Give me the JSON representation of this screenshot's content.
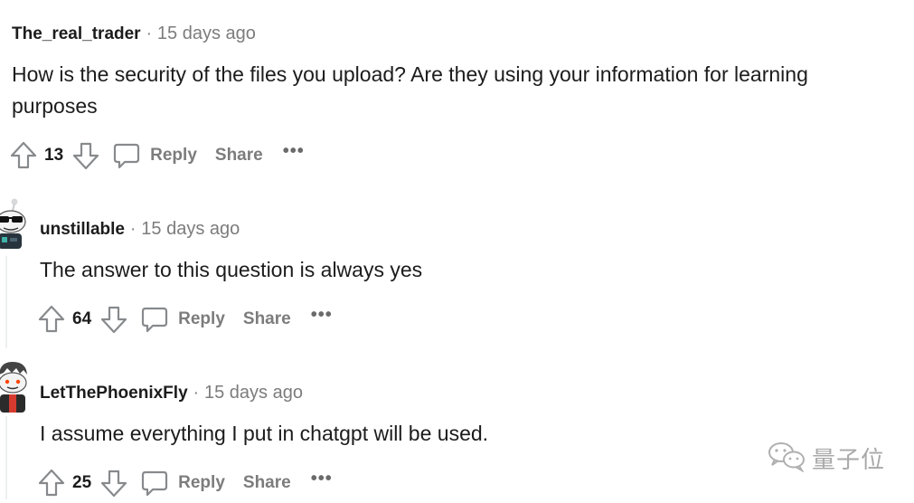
{
  "comments": [
    {
      "author": "The_real_trader",
      "separator": "·",
      "time": "15 days ago",
      "text": "How is the security of the files you upload? Are they using your information for learning purposes",
      "votes": "13",
      "reply_label": "Reply",
      "share_label": "Share",
      "more_label": "•••"
    },
    {
      "author": "unstillable",
      "separator": "·",
      "time": "15 days ago",
      "text": "The answer to this question is always yes",
      "votes": "64",
      "reply_label": "Reply",
      "share_label": "Share",
      "more_label": "•••"
    },
    {
      "author": "LetThePhoenixFly",
      "separator": "·",
      "time": "15 days ago",
      "text": "I assume everything I put in chatgpt will be used.",
      "votes": "25",
      "reply_label": "Reply",
      "share_label": "Share",
      "more_label": "•••"
    }
  ],
  "watermark": {
    "text": "量子位",
    "icon": "wechat-icon"
  },
  "colors": {
    "text": "#1c1c1c",
    "muted": "#7c7c7c",
    "icon": "#878a8c",
    "thread": "#edeff1"
  }
}
